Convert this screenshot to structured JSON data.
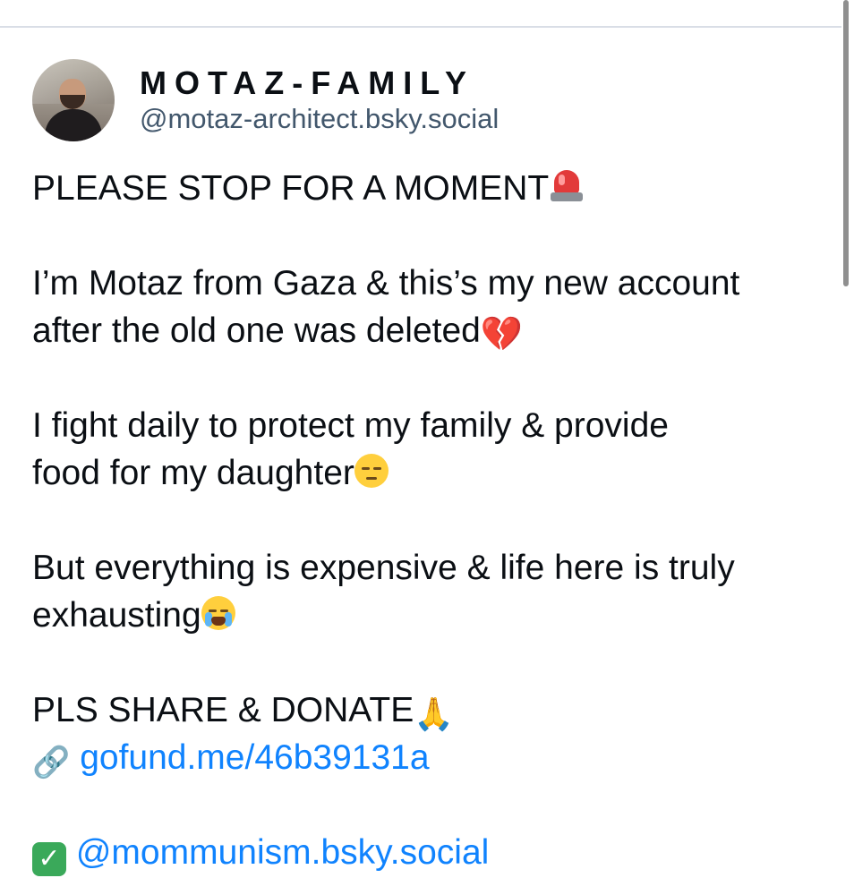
{
  "post": {
    "display_name": "MOTAZ-FAMILY",
    "handle": "@motaz-architect.bsky.social",
    "avatar_icon": "profile-photo",
    "paragraphs": {
      "p1": "PLEASE STOP FOR A MOMENT",
      "p2a": "I’m Motaz from Gaza & this’s my new account",
      "p2b": "after the old one was deleted",
      "p3a": "I fight daily to protect my family & provide",
      "p3b": "food for my daughter",
      "p4a": "But everything is expensive & life here is truly",
      "p4b": "exhausting",
      "p5": "PLS SHARE & DONATE",
      "link_url": "gofund.me/46b39131a",
      "mention": "@mommunism.bsky.social"
    },
    "emoji": {
      "siren": "rotating-light-icon",
      "broken_heart": "💔",
      "pensive": "pensive-face-icon",
      "crying": "loudly-crying-face-icon",
      "hands": "🙏",
      "link": "🔗",
      "check": "✓"
    }
  },
  "colors": {
    "link": "#1083fe",
    "handle": "#42576c",
    "text": "#0b0f14",
    "divider": "#d9dee6"
  }
}
